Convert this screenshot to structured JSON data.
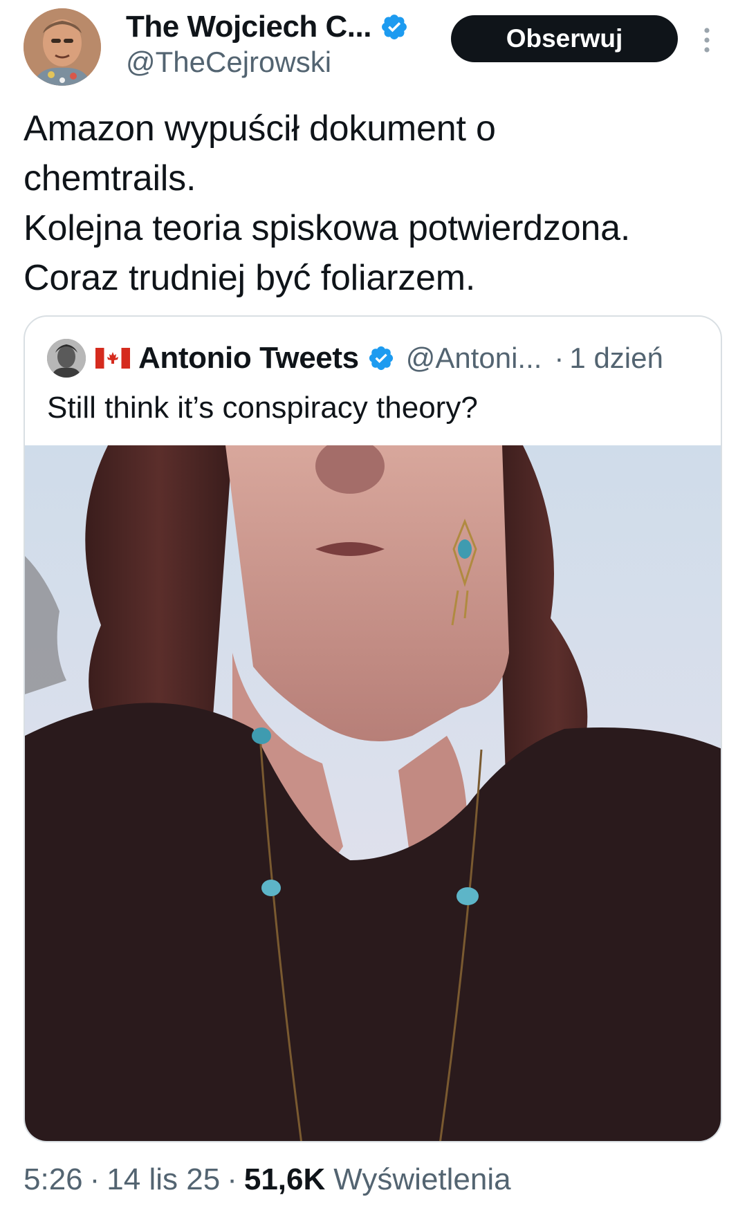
{
  "author": {
    "name": "The Wojciech C...",
    "handle": "@TheCejrowski",
    "verified": true,
    "avatar_icon": "user-avatar-photo"
  },
  "header": {
    "follow_label": "Obserwuj",
    "more_icon": "more-vertical-icon"
  },
  "tweet": {
    "lines": [
      "Amazon wypuścił dokument o",
      "chemtrails.",
      "Kolejna teoria spiskowa potwierdzona.",
      "Coraz trudniej być foliarzem."
    ]
  },
  "quote": {
    "name": "Antonio Tweets",
    "handle": "@Antoni...",
    "separator": "·",
    "time": "1 dzień",
    "text": "Still think it’s conspiracy theory?",
    "flag_icon": "canada-flag-icon",
    "media": {
      "type": "video",
      "muted": true,
      "mute_icon": "speaker-muted-icon"
    }
  },
  "meta": {
    "time": "5:26",
    "separator": "·",
    "date": "14 lis 25",
    "views_count": "51,6K",
    "views_label": "Wyświetlenia"
  },
  "colors": {
    "verified": "#1d9bf0",
    "text_primary": "#0f1419",
    "text_secondary": "#536471",
    "border": "#d9dfe3",
    "follow_button": "#0f1419"
  }
}
